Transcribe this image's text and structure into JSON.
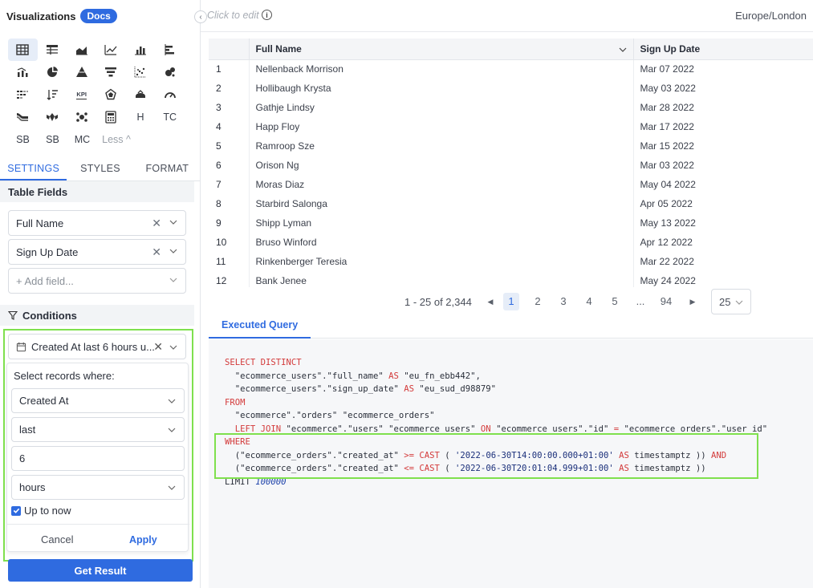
{
  "sidebar": {
    "title": "Visualizations",
    "docs_badge": "Docs",
    "viz_text_icons": [
      "H",
      "TC",
      "SB",
      "SB",
      "MC"
    ],
    "kpi_label": "KPI",
    "less_label": "Less ^",
    "tabs": [
      "SETTINGS",
      "STYLES",
      "FORMAT"
    ],
    "table_fields_heading": "Table Fields",
    "fields": [
      "Full Name",
      "Sign Up Date"
    ],
    "add_field_placeholder": "+ Add field...",
    "conditions_heading": "Conditions",
    "condition_summary": "Created At last 6 hours u...",
    "condition_popup": {
      "prompt": "Select records where:",
      "field": "Created At",
      "operator": "last",
      "amount": "6",
      "unit": "hours",
      "up_to_now_label": "Up to now",
      "up_to_now_checked": true,
      "cancel_label": "Cancel",
      "apply_label": "Apply"
    },
    "get_result_label": "Get Result"
  },
  "topbar": {
    "click_to_edit": "Click to edit",
    "timezone": "Europe/London"
  },
  "table": {
    "columns": [
      "Full Name",
      "Sign Up Date"
    ],
    "rows": [
      [
        "1",
        "Nellenback Morrison",
        "Mar 07 2022"
      ],
      [
        "2",
        "Hollibaugh Krysta",
        "May 03 2022"
      ],
      [
        "3",
        "Gathje Lindsy",
        "Mar 28 2022"
      ],
      [
        "4",
        "Happ Floy",
        "Mar 17 2022"
      ],
      [
        "5",
        "Ramroop Sze",
        "Mar 15 2022"
      ],
      [
        "6",
        "Orison Ng",
        "Mar 03 2022"
      ],
      [
        "7",
        "Moras Diaz",
        "May 04 2022"
      ],
      [
        "8",
        "Starbird Salonga",
        "Apr 05 2022"
      ],
      [
        "9",
        "Shipp Lyman",
        "May 13 2022"
      ],
      [
        "10",
        "Bruso Winford",
        "Apr 12 2022"
      ],
      [
        "11",
        "Rinkenberger Teresia",
        "Mar 22 2022"
      ],
      [
        "12",
        "Bank Jenee",
        "May 24 2022"
      ]
    ]
  },
  "pagination": {
    "summary": "1 - 25 of 2,344",
    "pages": [
      "1",
      "2",
      "3",
      "4",
      "5",
      "...",
      "94"
    ],
    "current_page": "1",
    "page_size": "25"
  },
  "query": {
    "tab_label": "Executed Query",
    "lines": [
      [
        [
          "kw",
          "SELECT DISTINCT"
        ]
      ],
      [
        [
          "t",
          "  \"ecommerce_users\".\"full_name\" "
        ],
        [
          "kw",
          "AS"
        ],
        [
          "t",
          " \"eu_fn_ebb442\","
        ]
      ],
      [
        [
          "t",
          "  \"ecommerce_users\".\"sign_up_date\" "
        ],
        [
          "kw",
          "AS"
        ],
        [
          "t",
          " \"eu_sud_d98879\""
        ]
      ],
      [
        [
          "kw",
          "FROM"
        ]
      ],
      [
        [
          "t",
          "  \"ecommerce\".\"orders\" \"ecommerce_orders\""
        ]
      ],
      [
        [
          "t",
          "  "
        ],
        [
          "kw",
          "LEFT JOIN"
        ],
        [
          "t",
          " \"ecommerce\".\"users\" \"ecommerce_users\" "
        ],
        [
          "kw",
          "ON"
        ],
        [
          "t",
          " \"ecommerce_users\".\"id\" "
        ],
        [
          "kw",
          "="
        ],
        [
          "t",
          " \"ecommerce_orders\".\"user_id\""
        ]
      ],
      [
        [
          "kw",
          "WHERE"
        ]
      ],
      [
        [
          "t",
          "  (\"ecommerce_orders\".\"created_at\" "
        ],
        [
          "kw",
          ">="
        ],
        [
          "t",
          " "
        ],
        [
          "kw",
          "CAST"
        ],
        [
          "t",
          " ( "
        ],
        [
          "str",
          "'2022-06-30T14:00:00.000+01:00'"
        ],
        [
          "t",
          " "
        ],
        [
          "kw",
          "AS"
        ],
        [
          "t",
          " timestamptz )) "
        ],
        [
          "kw",
          "AND"
        ]
      ],
      [
        [
          "t",
          "  (\"ecommerce_orders\".\"created_at\" "
        ],
        [
          "kw",
          "<="
        ],
        [
          "t",
          " "
        ],
        [
          "kw",
          "CAST"
        ],
        [
          "t",
          " ( "
        ],
        [
          "str",
          "'2022-06-30T20:01:04.999+01:00'"
        ],
        [
          "t",
          " "
        ],
        [
          "kw",
          "AS"
        ],
        [
          "t",
          " timestamptz ))"
        ]
      ],
      [
        [
          "t",
          "LIMIT "
        ],
        [
          "num",
          "100000"
        ]
      ]
    ]
  },
  "colors": {
    "accent": "#2f6be0",
    "highlight_outline": "#7fe04e",
    "sql_keyword": "#d33a3a"
  }
}
